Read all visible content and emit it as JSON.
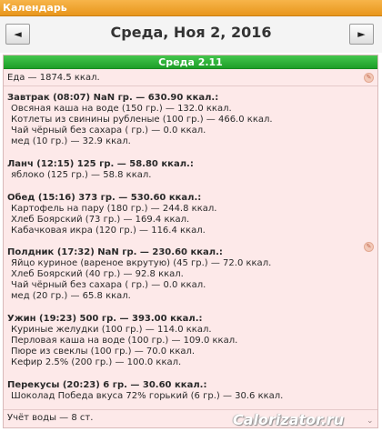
{
  "window": {
    "title": "Календарь"
  },
  "nav": {
    "prev_label": "◄",
    "next_label": "►",
    "date_title": "Среда, Ноя 2, 2016"
  },
  "day": {
    "header": "Среда 2.11",
    "food_total": "Еда — 1874.5 ккал.",
    "meals": [
      {
        "title": "Завтрак (08:07) NaN гр. — 630.90 ккал.:",
        "items": [
          "Овсяная каша на воде (150 гр.) — 132.0 ккал.",
          "Котлеты из свинины рубленые (100 гр.) — 466.0 ккал.",
          "Чай чёрный без сахара ( гр.) — 0.0 ккал.",
          "мед (10 гр.) — 32.9 ккал."
        ]
      },
      {
        "title": "Ланч (12:15) 125 гр. — 58.80 ккал.:",
        "items": [
          "яблоко (125 гр.) — 58.8 ккал."
        ]
      },
      {
        "title": "Обед (15:16) 373 гр. — 530.60 ккал.:",
        "items": [
          "Картофель на пару (180 гр.) — 244.8 ккал.",
          "Хлеб Боярский (73 гр.) — 169.4 ккал.",
          "Кабачковая икра (120 гр.) — 116.4 ккал."
        ]
      },
      {
        "title": "Полдник (17:32) NaN гр. — 230.60 ккал.:",
        "items": [
          "Яйцо куриное (вареное вкрутую) (45 гр.) — 72.0 ккал.",
          "Хлеб Боярский (40 гр.) — 92.8 ккал.",
          "Чай чёрный без сахара ( гр.) — 0.0 ккал.",
          "мед (20 гр.) — 65.8 ккал."
        ]
      },
      {
        "title": "Ужин (19:23) 500 гр. — 393.00 ккал.:",
        "items": [
          "Куриные желудки (100 гр.) — 114.0 ккал.",
          "Перловая каша на воде (100 гр.) — 109.0 ккал.",
          "Пюре из свеклы (100 гр.) — 70.0 ккал.",
          "Кефир 2.5% (200 гр.) — 100.0 ккал."
        ]
      },
      {
        "title": "Перекусы (20:23) 6 гр. — 30.60 ккал.:",
        "items": [
          "Шоколад Победа вкуса 72% горький (6 гр.) — 30.6 ккал."
        ]
      }
    ],
    "water": "Учёт воды — 8 ст."
  },
  "watermark": "Calorizator.ru"
}
